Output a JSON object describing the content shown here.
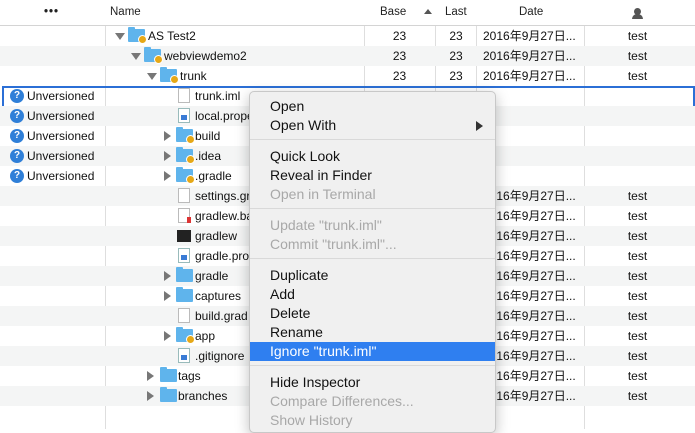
{
  "header": {
    "status_dots": "•••",
    "name": "Name",
    "base": "Base",
    "last": "Last",
    "date": "Date"
  },
  "rows": [
    {
      "name": "AS Test2",
      "base": "23",
      "last": "23",
      "date": "2016年9月27日...",
      "user": "test"
    },
    {
      "name": "webviewdemo2",
      "base": "23",
      "last": "23",
      "date": "2016年9月27日...",
      "user": "test"
    },
    {
      "name": "trunk",
      "base": "23",
      "last": "23",
      "date": "2016年9月27日...",
      "user": "test"
    },
    {
      "status": "Unversioned",
      "name": "trunk.iml"
    },
    {
      "status": "Unversioned",
      "name": "local.prope"
    },
    {
      "status": "Unversioned",
      "name": "build"
    },
    {
      "status": "Unversioned",
      "name": ".idea"
    },
    {
      "status": "Unversioned",
      "name": ".gradle"
    },
    {
      "name": "settings.gr",
      "date": "2016年9月27日...",
      "user": "test"
    },
    {
      "name": "gradlew.ba",
      "date": "2016年9月27日...",
      "user": "test"
    },
    {
      "name": "gradlew",
      "date": "2016年9月27日...",
      "user": "test"
    },
    {
      "name": "gradle.pro",
      "date": "2016年9月27日...",
      "user": "test"
    },
    {
      "name": "gradle",
      "date": "2016年9月27日...",
      "user": "test"
    },
    {
      "name": "captures",
      "date": "2016年9月27日...",
      "user": "test"
    },
    {
      "name": "build.grad",
      "date": "2016年9月27日...",
      "user": "test"
    },
    {
      "name": "app",
      "date": "2016年9月27日...",
      "user": "test"
    },
    {
      "name": ".gitignore",
      "date": "2016年9月27日...",
      "user": "test"
    },
    {
      "name": "tags",
      "date": "2016年9月27日...",
      "user": "test"
    },
    {
      "name": "branches",
      "date": "2016年9月27日...",
      "user": "test"
    }
  ],
  "menu": {
    "open": "Open",
    "open_with": "Open With",
    "quick_look": "Quick Look",
    "reveal": "Reveal in Finder",
    "open_terminal": "Open in Terminal",
    "update": "Update \"trunk.iml\"",
    "commit": "Commit \"trunk.iml\"...",
    "duplicate": "Duplicate",
    "add": "Add",
    "delete": "Delete",
    "rename": "Rename",
    "ignore": "Ignore \"trunk.iml\"",
    "hide_inspector": "Hide Inspector",
    "compare": "Compare Differences...",
    "history": "Show History"
  },
  "colors": {
    "selection": "#2b6fd6",
    "menu_highlight": "#2f7ff0",
    "folder": "#5fb4ec",
    "status_icon": "#2f7fd8"
  }
}
